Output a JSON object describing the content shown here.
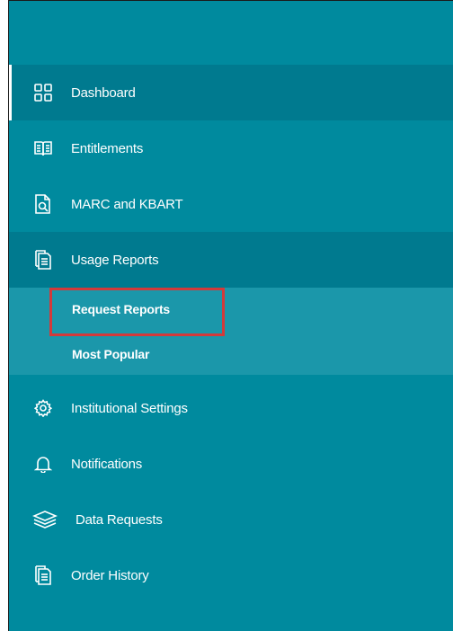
{
  "sidebar": {
    "items": [
      {
        "label": "Dashboard",
        "icon": "dashboard-grid-icon"
      },
      {
        "label": "Entitlements",
        "icon": "book-icon"
      },
      {
        "label": "MARC and KBART",
        "icon": "document-search-icon"
      },
      {
        "label": "Usage Reports",
        "icon": "report-document-icon"
      },
      {
        "label": "Institutional Settings",
        "icon": "gear-icon"
      },
      {
        "label": "Notifications",
        "icon": "bell-icon"
      },
      {
        "label": "Data Requests",
        "icon": "layers-icon"
      },
      {
        "label": "Order History",
        "icon": "order-document-icon"
      }
    ],
    "submenu": [
      {
        "label": "Request Reports"
      },
      {
        "label": "Most Popular"
      }
    ]
  },
  "colors": {
    "sidebar_bg": "#008a9e",
    "item_active_bg": "#007a8f",
    "submenu_bg": "#1b97aa",
    "highlight": "#d33a3a"
  }
}
